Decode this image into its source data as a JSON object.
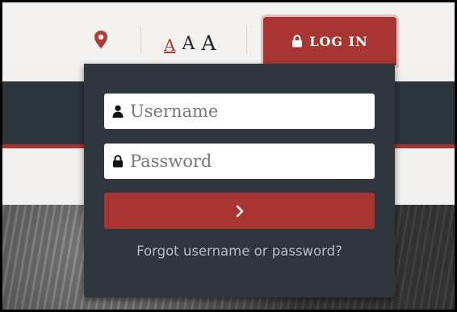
{
  "topbar": {
    "location_icon": "map-marker-icon",
    "text_size": {
      "small": "A",
      "medium": "A",
      "large": "A"
    },
    "login_tab": {
      "icon": "lock-icon",
      "label": "LOG IN"
    }
  },
  "login_dropdown": {
    "username": {
      "icon": "user-icon",
      "placeholder": "Username",
      "value": ""
    },
    "password": {
      "icon": "lock-icon",
      "placeholder": "Password",
      "value": ""
    },
    "submit": {
      "icon": "chevron-right-icon"
    },
    "forgot_link": "Forgot username or password?"
  },
  "colors": {
    "accent_red": "#a93532",
    "panel_dark": "#2f363e",
    "band_dark": "#2c343c",
    "link_muted": "#b6bcc2"
  }
}
